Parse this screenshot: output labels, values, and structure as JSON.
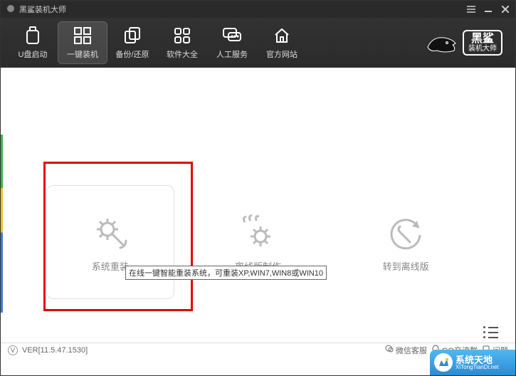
{
  "titlebar": {
    "title": "黑鲨装机大师"
  },
  "toolbar": {
    "items": [
      {
        "label": "U盘启动"
      },
      {
        "label": "一键装机"
      },
      {
        "label": "备份/还原"
      },
      {
        "label": "软件大全"
      },
      {
        "label": "人工服务"
      },
      {
        "label": "官方网站"
      }
    ]
  },
  "brand": {
    "line1": "黑鲨",
    "line2": "装机大师"
  },
  "main": {
    "cards": [
      {
        "label": "系统重装"
      },
      {
        "label": "离线版制作"
      },
      {
        "label": "转到离线版"
      }
    ],
    "tooltip": "在线一键智能重装系统，可重装XP,WIN7,WIN8或WIN10"
  },
  "statusbar": {
    "v": "V",
    "version": "VER[11.5.47.1530]",
    "wechat": "微信客服",
    "qq": "QQ交流群",
    "question": "问题"
  },
  "watermark": {
    "line1": "系统天地",
    "line2": "XiTongTianDi.net"
  }
}
